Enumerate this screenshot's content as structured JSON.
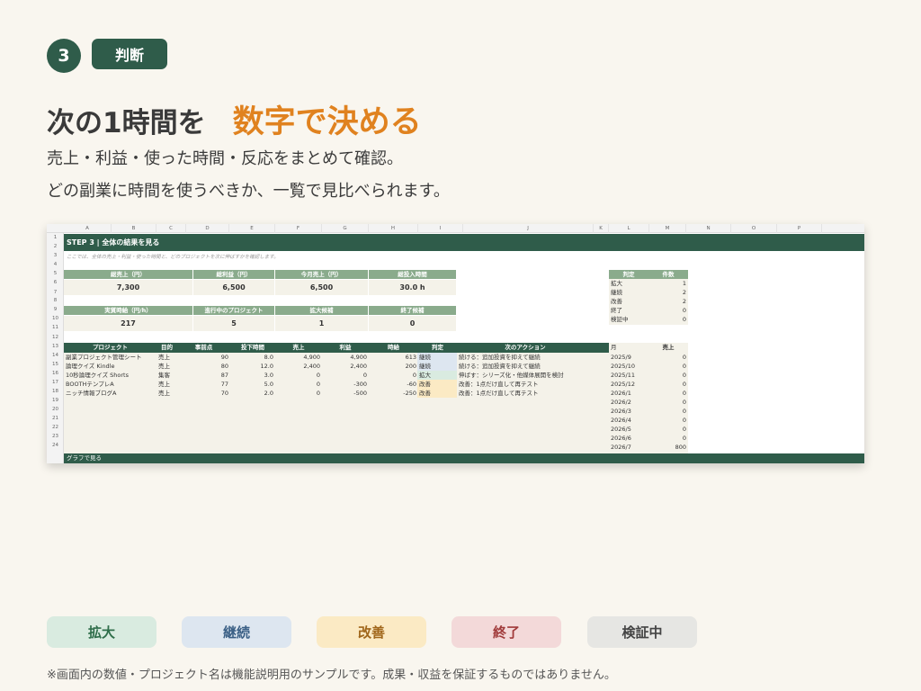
{
  "step": {
    "number": "3",
    "tag": "判断"
  },
  "headline": {
    "main": "次の1時間を",
    "accent": "数字で決める"
  },
  "subtitle": {
    "line1": "売上・利益・使った時間・反応をまとめて確認。",
    "line2": "どの副業に時間を使うべきか、一覧で見比べられます。"
  },
  "sheet": {
    "columns": [
      "A",
      "B",
      "C",
      "D",
      "E",
      "F",
      "G",
      "H",
      "I",
      "J",
      "K",
      "L",
      "M",
      "N",
      "O",
      "P"
    ],
    "rows": [
      "1",
      "2",
      "3",
      "4",
      "5",
      "6",
      "7",
      "8",
      "9",
      "10",
      "11",
      "12",
      "13",
      "14",
      "15",
      "16",
      "17",
      "18",
      "19",
      "20",
      "21",
      "22",
      "23",
      "24"
    ],
    "title": "STEP 3 | 全体の結果を見る",
    "note": "ここでは、全体の売上・利益・使った時間と、どのプロジェクトを次に伸ばすかを確認します。",
    "kpi1": [
      {
        "label": "総売上（円）",
        "value": "7,300"
      },
      {
        "label": "総利益（円）",
        "value": "6,500"
      },
      {
        "label": "今月売上（円）",
        "value": "6,500"
      },
      {
        "label": "総投入時間",
        "value": "30.0 h"
      }
    ],
    "kpi2": [
      {
        "label": "実質時給（円/h）",
        "value": "217"
      },
      {
        "label": "進行中のプロジェクト",
        "value": "5"
      },
      {
        "label": "拡大候補",
        "value": "1"
      },
      {
        "label": "終了候補",
        "value": "0"
      }
    ],
    "table_headers": [
      "プロジェクト",
      "目的",
      "事前点",
      "投下時間",
      "売上",
      "利益",
      "時給",
      "判定",
      "次のアクション"
    ],
    "table_rows": [
      [
        "副業プロジェクト管理シート",
        "売上",
        "90",
        "8.0",
        "4,900",
        "4,900",
        "613",
        "継続",
        "続ける：追加投資を抑えて継続"
      ],
      [
        "論理クイズ Kindle",
        "売上",
        "80",
        "12.0",
        "2,400",
        "2,400",
        "200",
        "継続",
        "続ける：追加投資を抑えて継続"
      ],
      [
        "10秒論理クイズ Shorts",
        "集客",
        "87",
        "3.0",
        "0",
        "0",
        "0",
        "拡大",
        "伸ばす：シリーズ化・他媒体展開を検討"
      ],
      [
        "BOOTHテンプレA",
        "売上",
        "77",
        "5.0",
        "0",
        "-300",
        "-60",
        "改善",
        "改善：1点だけ直して再テスト"
      ],
      [
        "ニッチ情報ブログA",
        "売上",
        "70",
        "2.0",
        "0",
        "-500",
        "-250",
        "改善",
        "改善：1点だけ直して再テスト"
      ]
    ],
    "judge_summary": {
      "headers": [
        "判定",
        "件数"
      ],
      "rows": [
        [
          "拡大",
          "1"
        ],
        [
          "継続",
          "2"
        ],
        [
          "改善",
          "2"
        ],
        [
          "終了",
          "0"
        ],
        [
          "検証中",
          "0"
        ]
      ]
    },
    "monthly": {
      "headers": [
        "月",
        "売上"
      ],
      "rows": [
        [
          "2025/9",
          "0"
        ],
        [
          "2025/10",
          "0"
        ],
        [
          "2025/11",
          "0"
        ],
        [
          "2025/12",
          "0"
        ],
        [
          "2026/1",
          "0"
        ],
        [
          "2026/2",
          "0"
        ],
        [
          "2026/3",
          "0"
        ],
        [
          "2026/4",
          "0"
        ],
        [
          "2026/5",
          "0"
        ],
        [
          "2026/6",
          "0"
        ],
        [
          "2026/7",
          "800"
        ]
      ]
    },
    "footer": "グラフで見る"
  },
  "legend": [
    {
      "label": "拡大",
      "bg": "#d9ebe0",
      "fg": "#2f6e4a"
    },
    {
      "label": "継続",
      "bg": "#dde6f0",
      "fg": "#3a5f85"
    },
    {
      "label": "改善",
      "bg": "#fbeac4",
      "fg": "#a0661a"
    },
    {
      "label": "終了",
      "bg": "#f3d9d9",
      "fg": "#a03a3a"
    },
    {
      "label": "検証中",
      "bg": "#e6e6e3",
      "fg": "#444444"
    }
  ],
  "judge_colors": {
    "拡大": "#d9ebe0",
    "継続": "#dde6f0",
    "改善": "#fbeac4",
    "終了": "#f3d9d9",
    "検証中": "#e6e6e3"
  },
  "disclaimer": "※画面内の数値・プロジェクト名は機能説明用のサンプルです。成果・収益を保証するものではありません。"
}
